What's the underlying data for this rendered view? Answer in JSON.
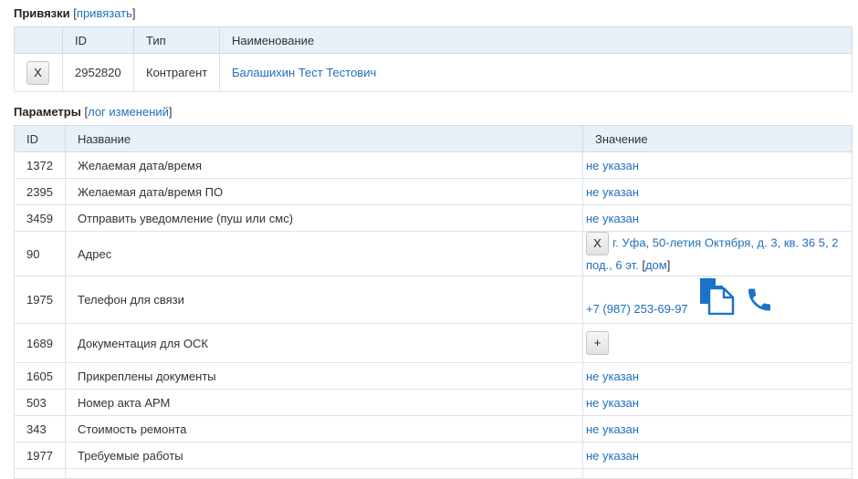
{
  "links": {
    "title": "Привязки",
    "action_label": "привязать",
    "headers": {
      "col_id": "ID",
      "col_type": "Тип",
      "col_name": "Наименование"
    },
    "rows": [
      {
        "remove_label": "X",
        "id": "2952820",
        "type": "Контрагент",
        "name": "Балашихин Тест Тестович"
      }
    ]
  },
  "params": {
    "title": "Параметры",
    "log_label": "лог изменений",
    "headers": {
      "col_id": "ID",
      "col_name": "Название",
      "col_value": "Значение"
    },
    "rows": [
      {
        "id": "1372",
        "name": "Желаемая дата/время",
        "value": "не указан"
      },
      {
        "id": "2395",
        "name": "Желаемая дата/время ПО",
        "value": "не указан"
      },
      {
        "id": "3459",
        "name": "Отправить уведомление (пуш или смс)",
        "value": "не указан"
      },
      {
        "id": "90",
        "name": "Адрес",
        "remove_label": "X",
        "value": "г. Уфа, 50-летия Октября, д. 3, кв. 36 5, 2 под., 6 эт.",
        "extra_link": "дом"
      },
      {
        "id": "1975",
        "name": "Телефон для связи",
        "value": "+7 (987) 253-69-97",
        "icons": [
          "copy-document-icon",
          "phone-icon"
        ]
      },
      {
        "id": "1689",
        "name": "Документация для ОСК",
        "add_label": "+"
      },
      {
        "id": "1605",
        "name": "Прикреплены документы",
        "value": "не указан"
      },
      {
        "id": "503",
        "name": "Номер акта АРМ",
        "value": "не указан"
      },
      {
        "id": "343",
        "name": "Стоимость ремонта",
        "value": "не указан"
      },
      {
        "id": "1977",
        "name": "Требуемые работы",
        "value": "не указан"
      }
    ]
  },
  "colors": {
    "link": "#1f6fbf",
    "header_bg": "#e8f0f8",
    "icon_blue": "#1a73c9"
  }
}
